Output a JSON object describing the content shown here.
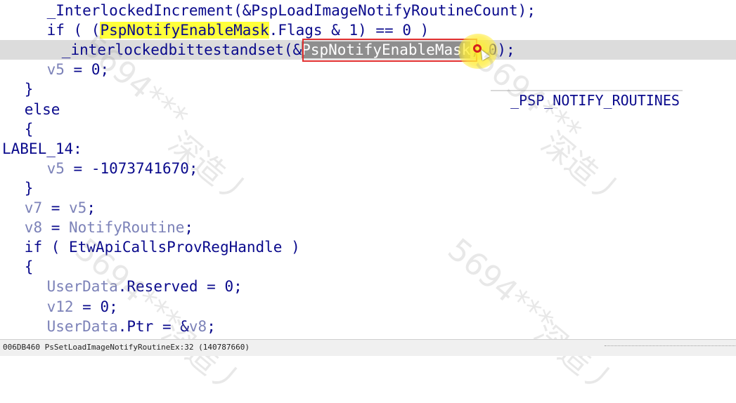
{
  "editor": {
    "lines": [
      {
        "indent": 6,
        "tokens": [
          {
            "text": "_InterlockedIncrement(&PspLoadImageNotifyRoutineCount);"
          }
        ]
      },
      {
        "indent": 6,
        "tokens": [
          {
            "text": "if ( ("
          },
          {
            "text": "PspNotifyEnableMask",
            "style": "hl"
          },
          {
            "text": ".Flags & 1) == 0 )"
          }
        ]
      },
      {
        "indent": 8,
        "current": true,
        "tokens": [
          {
            "text": "_interlockedbittestandset(&"
          },
          {
            "text": "PspNotifyEnableMask",
            "style": "sel"
          },
          {
            "text": ", 0);"
          }
        ]
      },
      {
        "indent": 6,
        "tokens": [
          {
            "text": "v5",
            "style": "var"
          },
          {
            "text": " = 0;"
          }
        ]
      },
      {
        "indent": 3,
        "tokens": [
          {
            "text": "}"
          }
        ]
      },
      {
        "indent": 3,
        "tokens": [
          {
            "text": "else"
          }
        ]
      },
      {
        "indent": 3,
        "tokens": [
          {
            "text": "{"
          }
        ]
      },
      {
        "indent": 0,
        "tokens": [
          {
            "text": "LABEL_14:"
          }
        ]
      },
      {
        "indent": 6,
        "tokens": [
          {
            "text": "v5",
            "style": "var"
          },
          {
            "text": " = -1073741670;"
          }
        ]
      },
      {
        "indent": 3,
        "tokens": [
          {
            "text": "}"
          }
        ]
      },
      {
        "indent": 3,
        "tokens": [
          {
            "text": "v7",
            "style": "var"
          },
          {
            "text": " = "
          },
          {
            "text": "v5",
            "style": "var"
          },
          {
            "text": ";"
          }
        ]
      },
      {
        "indent": 3,
        "tokens": [
          {
            "text": "v8",
            "style": "var"
          },
          {
            "text": " = "
          },
          {
            "text": "NotifyRoutine",
            "style": "var"
          },
          {
            "text": ";"
          }
        ]
      },
      {
        "indent": 3,
        "tokens": [
          {
            "text": "if ( "
          },
          {
            "text": "EtwApiCallsProvRegHandle"
          },
          {
            "text": " )"
          }
        ]
      },
      {
        "indent": 3,
        "tokens": [
          {
            "text": "{"
          }
        ]
      },
      {
        "indent": 6,
        "tokens": [
          {
            "text": "UserData",
            "style": "var"
          },
          {
            "text": ".Reserved = 0;"
          }
        ]
      },
      {
        "indent": 6,
        "tokens": [
          {
            "text": "v12",
            "style": "var"
          },
          {
            "text": " = 0;"
          }
        ]
      },
      {
        "indent": 6,
        "tokens": [
          {
            "text": "UserData",
            "style": "var"
          },
          {
            "text": ".Ptr = &"
          },
          {
            "text": "v8",
            "style": "var"
          },
          {
            "text": ";"
          }
        ]
      }
    ]
  },
  "hover_hint": {
    "text": "_PSP_NOTIFY_ROUTINES"
  },
  "status_bar": {
    "text": "006DB460 PsSetLoadImageNotifyRoutineEx:32 (140787660)"
  },
  "watermarks": [
    "5694***",
    "深造丿",
    "5694***",
    "深造丿",
    "5694***",
    "深造丿",
    "5694***",
    "深造丿"
  ],
  "colors": {
    "code_text": "#0a0a8c",
    "variable": "#7c82b8",
    "highlight": "#ffff3a",
    "selection": "#8e8e8e",
    "current_line": "#dcdcdc",
    "annotation_box": "#e23030"
  }
}
